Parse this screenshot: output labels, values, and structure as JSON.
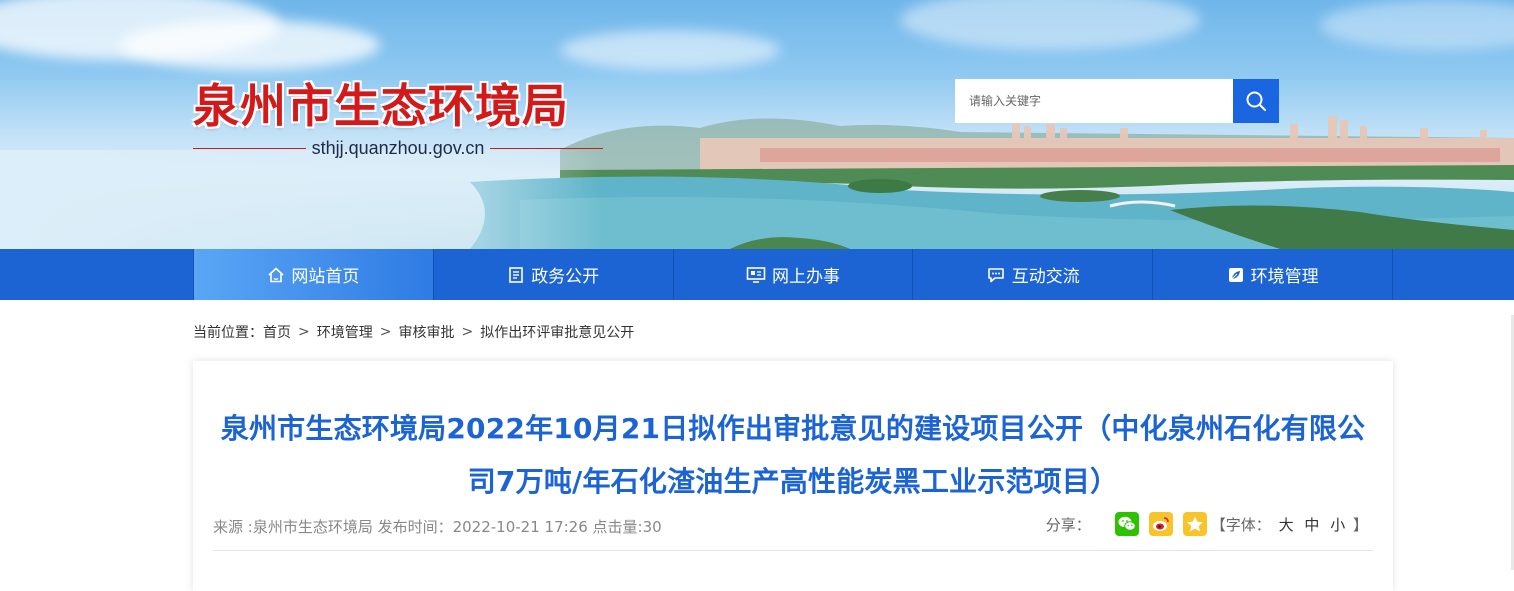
{
  "header": {
    "site_name": "泉州市生态环境局",
    "site_url": "sthjj.quanzhou.gov.cn",
    "search_placeholder": "请输入关键字",
    "search_icon": "search-icon"
  },
  "nav": {
    "items": [
      {
        "label": "网站首页",
        "icon": "home-icon"
      },
      {
        "label": "政务公开",
        "icon": "document-icon"
      },
      {
        "label": "网上办事",
        "icon": "monitor-icon"
      },
      {
        "label": "互动交流",
        "icon": "chat-icon"
      },
      {
        "label": "环境管理",
        "icon": "leaf-icon"
      }
    ]
  },
  "breadcrumb": {
    "prefix": "当前位置：",
    "items": [
      "首页",
      "环境管理",
      "审核审批",
      "拟作出环评审批意见公开"
    ],
    "separator": ">"
  },
  "article": {
    "title": "泉州市生态环境局2022年10月21日拟作出审批意见的建设项目公开（中化泉州石化有限公司7万吨/年石化渣油生产高性能炭黑工业示范项目）",
    "meta": "来源 :泉州市生态环境局 发布时间：2022-10-21 17:26 点击量:30",
    "share_label": "分享：",
    "font_size": {
      "open": "【字体：",
      "large": "大",
      "medium": "中",
      "small": "小",
      "close": "】"
    }
  },
  "colors": {
    "brand_blue": "#1c64d4",
    "title_red": "#d31a1a",
    "wechat_green": "#2dc100",
    "weibo_yellow": "#f7c52a",
    "qzone_yellow": "#f7c52a"
  }
}
